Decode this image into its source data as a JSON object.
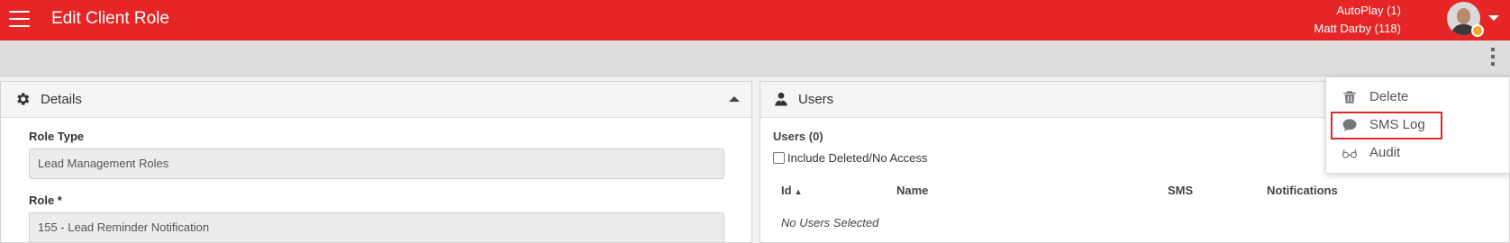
{
  "header": {
    "title": "Edit Client Role",
    "user_line1": "AutoPlay (1)",
    "user_line2": "Matt Darby (118)",
    "accent_color": "#e52526"
  },
  "details": {
    "title": "Details",
    "role_type_label": "Role Type",
    "role_type_value": "Lead Management Roles",
    "role_label": "Role *",
    "role_value": "155 - Lead Reminder Notification"
  },
  "users": {
    "title": "Users",
    "count_label": "Users (0)",
    "include_deleted_label": "Include Deleted/No Access",
    "include_deleted_checked": false,
    "columns": [
      "Id",
      "Name",
      "SMS",
      "Notifications"
    ],
    "sort_indicator": "▲",
    "empty_text": "No Users Selected"
  },
  "actions_menu": {
    "items": [
      {
        "label": "Delete",
        "icon": "trash-icon"
      },
      {
        "label": "SMS Log",
        "icon": "chat-bubble-icon",
        "highlighted": true
      },
      {
        "label": "Audit",
        "icon": "glasses-icon"
      }
    ]
  }
}
